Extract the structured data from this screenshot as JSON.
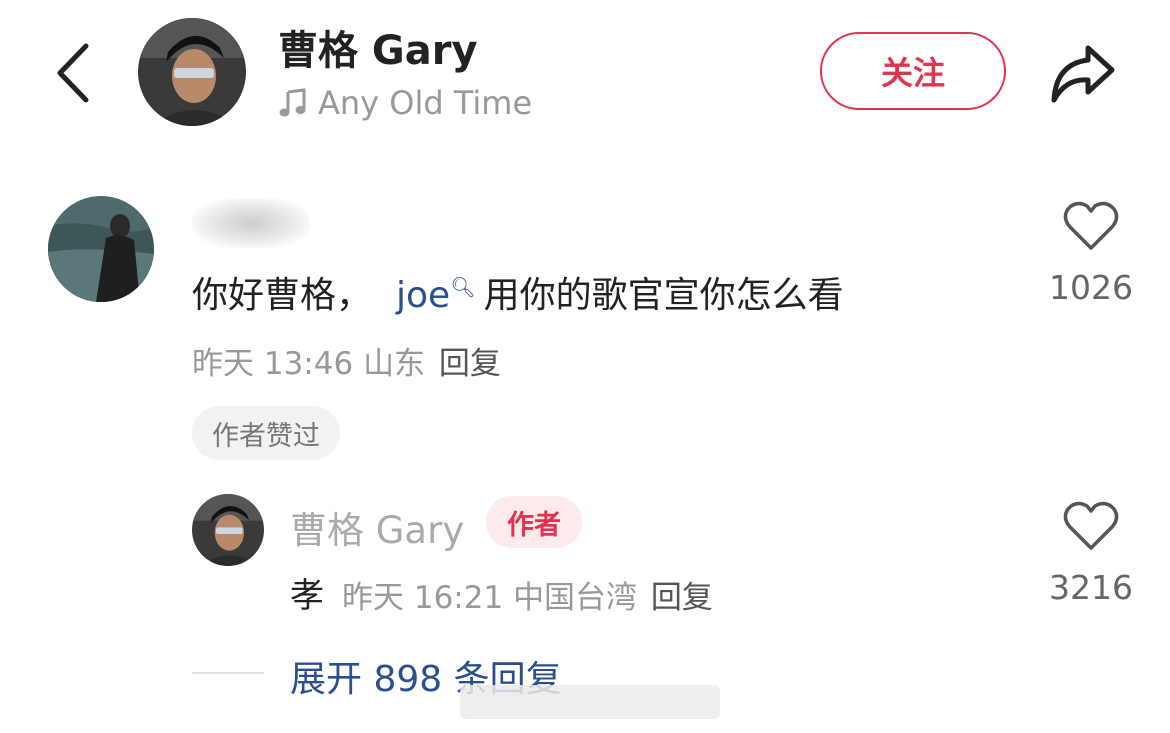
{
  "header": {
    "name": "曹格 Gary",
    "song": "Any Old Time",
    "follow_label": "关注",
    "back_icon": "chevron-left-icon",
    "share_icon": "share-arrow-icon",
    "music_icon": "music-note-icon"
  },
  "comment": {
    "text_before": "你好曹格，",
    "mention": "joe",
    "text_after": "用你的歌官宣你怎么看",
    "time": "昨天 13:46",
    "location": "山东",
    "reply_label": "回复",
    "badge": "作者赞过",
    "like_count": "1026"
  },
  "reply": {
    "name": "曹格 Gary",
    "author_badge": "作者",
    "text": "孝",
    "time": "昨天 16:21",
    "location": "中国台湾",
    "reply_label": "回复",
    "like_count": "3216"
  },
  "expand_label": "展开 898 条回复",
  "colors": {
    "accent": "#e0334f",
    "link": "#2a4f8f",
    "muted": "#999999"
  }
}
